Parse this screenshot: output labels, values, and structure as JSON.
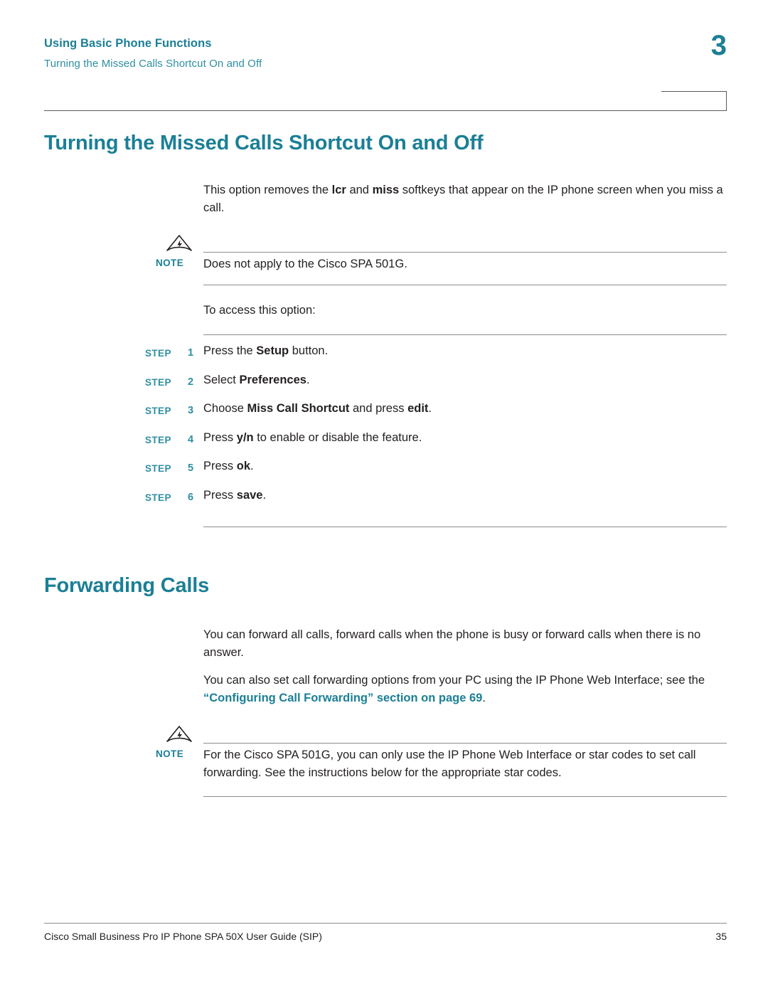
{
  "header": {
    "chapter_title": "Using Basic Phone Functions",
    "section_subtitle": "Turning the Missed Calls Shortcut On and Off",
    "chapter_number": "3"
  },
  "sections": [
    {
      "title": "Turning the Missed Calls Shortcut On and Off"
    },
    {
      "title": "Forwarding Calls"
    }
  ],
  "paragraphs": {
    "intro_1": "This option removes the ",
    "intro_lcr": "lcr",
    "intro_2": " and ",
    "intro_miss": "miss",
    "intro_3": " softkeys that appear on the IP phone screen when you miss a call.",
    "access": "To access this option:",
    "forward_1": "You can forward all calls, forward calls when the phone is busy or forward calls when there is no answer.",
    "forward_2a": "You can also set call forwarding options from your PC using the IP Phone Web Interface; see the ",
    "forward_2_link": "“Configuring Call Forwarding” section on page 69",
    "forward_2b": "."
  },
  "notes": [
    {
      "label": "NOTE",
      "icon": "note-triangle-icon",
      "text": "Does not apply to the Cisco SPA 501G."
    },
    {
      "label": "NOTE",
      "icon": "note-triangle-icon",
      "text": "For the Cisco SPA 501G, you can only use the IP Phone Web Interface or star codes to set call forwarding. See the instructions below for the appropriate star codes."
    }
  ],
  "steps": {
    "tag": "STEP",
    "items": [
      {
        "number": "1",
        "pre": "Press the ",
        "bold": "Setup",
        "post": " button."
      },
      {
        "number": "2",
        "pre": "Select ",
        "bold": "Preferences",
        "post": "."
      },
      {
        "number": "3",
        "pre": "Choose ",
        "bold": "Miss Call Shortcut",
        "post": " and press ",
        "bold2": "edit",
        "post2": "."
      },
      {
        "number": "4",
        "pre": "Press ",
        "bold": "y/n",
        "post": " to enable or disable the feature."
      },
      {
        "number": "5",
        "pre": "Press ",
        "bold": "ok",
        "post": "."
      },
      {
        "number": "6",
        "pre": "Press ",
        "bold": "save",
        "post": "."
      }
    ]
  },
  "footer": {
    "left": "Cisco Small Business Pro IP Phone SPA 50X User Guide (SIP)",
    "page_number": "35"
  },
  "colors": {
    "accent": "#1b7f96",
    "accent_light": "#2e8fa3",
    "text": "#231f20",
    "rule": "#8d8d8d"
  }
}
